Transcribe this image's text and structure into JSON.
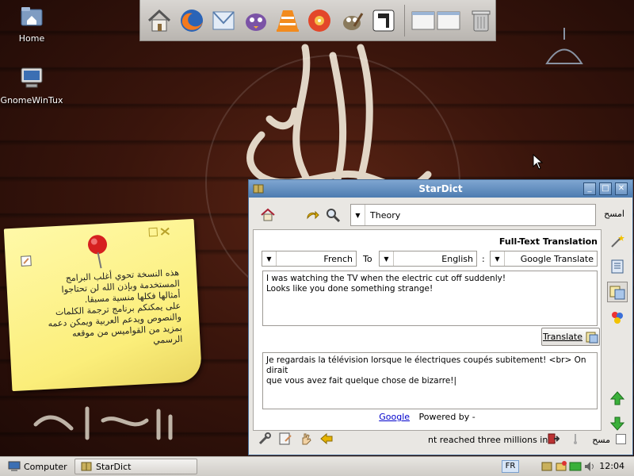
{
  "desktop": {
    "icons": [
      {
        "label": "Home"
      },
      {
        "label": "GnomeWinTux"
      }
    ],
    "calligraphy_bottom": "الا رسول الله"
  },
  "dock": {
    "items": [
      "home-folder",
      "firefox",
      "mail",
      "pidgin",
      "vlc",
      "brasero",
      "gimp",
      "inkscape",
      "windows",
      "trash"
    ]
  },
  "sticky": {
    "text": "هذه النسخة تحوي أغلب البرامج\nالمستخدمة وبإذن الله لن تحتاجوا\nأمثالها فكلها منسية مسبقا.\nعلى يمكنكم برنامج ترجمة الكلمات\nوالنصوص ويدعم العربية ويمكن دعمه\nبمزيد من القواميس من موقعه\nالرسمي"
  },
  "stardict": {
    "title": "StarDict",
    "search": {
      "value": "Theory",
      "clear_label": "امسح"
    },
    "fulltext": {
      "title": "Full-Text Translation",
      "from_lang": "French",
      "to_label": "To",
      "to_lang": "English",
      "sep": ":",
      "engine": "Google Translate",
      "source_text": "I was watching the TV when the electric cut off suddenly!\nLooks like you done something strange!",
      "translate_label": "Translate",
      "result_text": "Je regardais la télévision lorsque le électriques coupés subitement! <br> On dirait\nque vous avez fait quelque chose de bizarre!|",
      "powered_link": "Google",
      "powered_text": "Powered by -"
    },
    "bottom": {
      "scan_text": "nt reached three millions in 2",
      "scan_label": "مسح"
    }
  },
  "taskbar": {
    "computer_label": "Computer",
    "task_label": "StarDict",
    "lang": "FR",
    "clock": "12:04"
  },
  "colors": {
    "title_blue": "#4d7bb0",
    "sticky_yellow": "#fbee7a",
    "link": "#0000cc"
  }
}
